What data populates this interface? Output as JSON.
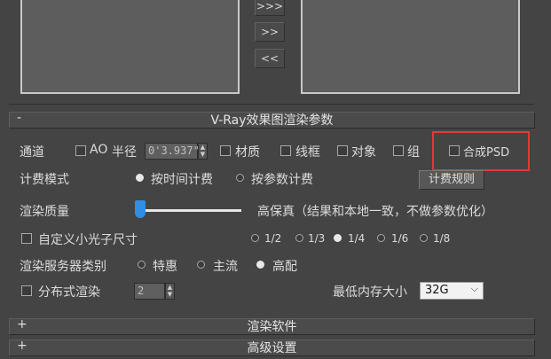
{
  "top_buttons": {
    "add_all": ">>>",
    "add": ">>",
    "remove": "<<"
  },
  "main_rollout": {
    "sign": "-",
    "title": "V-Ray效果图渲染参数"
  },
  "channels": {
    "label": "通道",
    "ao": "AO",
    "radius_label": "半径",
    "radius_value": "0'3.937\"",
    "material": "材质",
    "wireframe": "线框",
    "object": "对象",
    "group": "组",
    "composite_psd": "合成PSD"
  },
  "billing": {
    "label": "计费模式",
    "by_time": "按时间计费",
    "by_param": "按参数计费",
    "rules_button": "计费规则",
    "selected": "按时间计费"
  },
  "quality": {
    "label": "渲染质量",
    "level": 0.0,
    "description": "高保真（结果和本地一致，不做参数优化）"
  },
  "photon": {
    "label": "自定义小光子尺寸",
    "options": [
      "1/2",
      "1/3",
      "1/4",
      "1/6",
      "1/8"
    ],
    "selected": "1/4"
  },
  "server": {
    "label": "渲染服务器类别",
    "options": [
      "特惠",
      "主流",
      "高配"
    ],
    "selected": "高配"
  },
  "distributed": {
    "label": "分布式渲染",
    "count": "2",
    "memory_label": "最低内存大小",
    "memory_value": "32G"
  },
  "render_software": {
    "sign": "+",
    "title": "渲染软件"
  },
  "advanced": {
    "sign": "+",
    "title": "高级设置"
  },
  "colors": {
    "background": "#444444",
    "highlight": "#e53935",
    "text": "#dedede"
  }
}
